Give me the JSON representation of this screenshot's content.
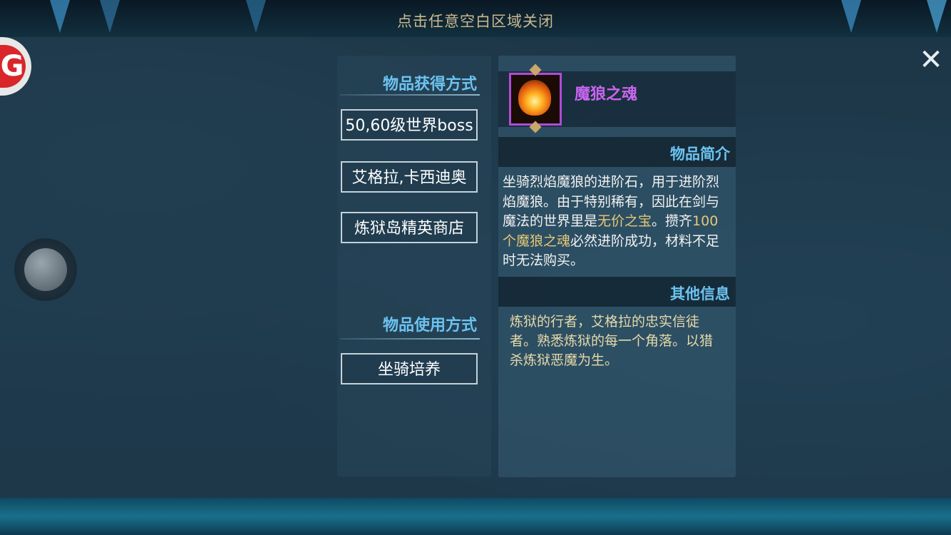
{
  "hint": "点击任意空白区域关闭",
  "close_label": "✕",
  "logo_glyph": "G",
  "acquire": {
    "title": "物品获得方式",
    "sources": [
      "50,60级世界boss",
      "艾格拉,卡西迪奥",
      "炼狱岛精英商店"
    ]
  },
  "usage": {
    "title": "物品使用方式",
    "methods": [
      "坐骑培养"
    ]
  },
  "item": {
    "name": "魔狼之魂",
    "icon": "flame-soul-icon",
    "intro_title": "物品简介",
    "desc_part1": "坐骑烈焰魔狼的进阶石，用于进阶烈焰魔狼。由于特别稀有，因此在剑与魔法的世界里是",
    "desc_highlight1": "无价之宝",
    "desc_part2": "。攒齐",
    "desc_highlight2": "100个魔狼之魂",
    "desc_part3": "必然进阶成功，材料不足时无法购买。",
    "other_title": "其他信息",
    "other_text": "炼狱的行者，艾格拉的忠实信徒者。熟悉炼狱的每一个角落。以猎杀炼狱恶魔为生。"
  },
  "colors": {
    "accent_blue": "#6cc3f0",
    "item_purple": "#c965f0",
    "highlight_gold": "#e6c877"
  }
}
